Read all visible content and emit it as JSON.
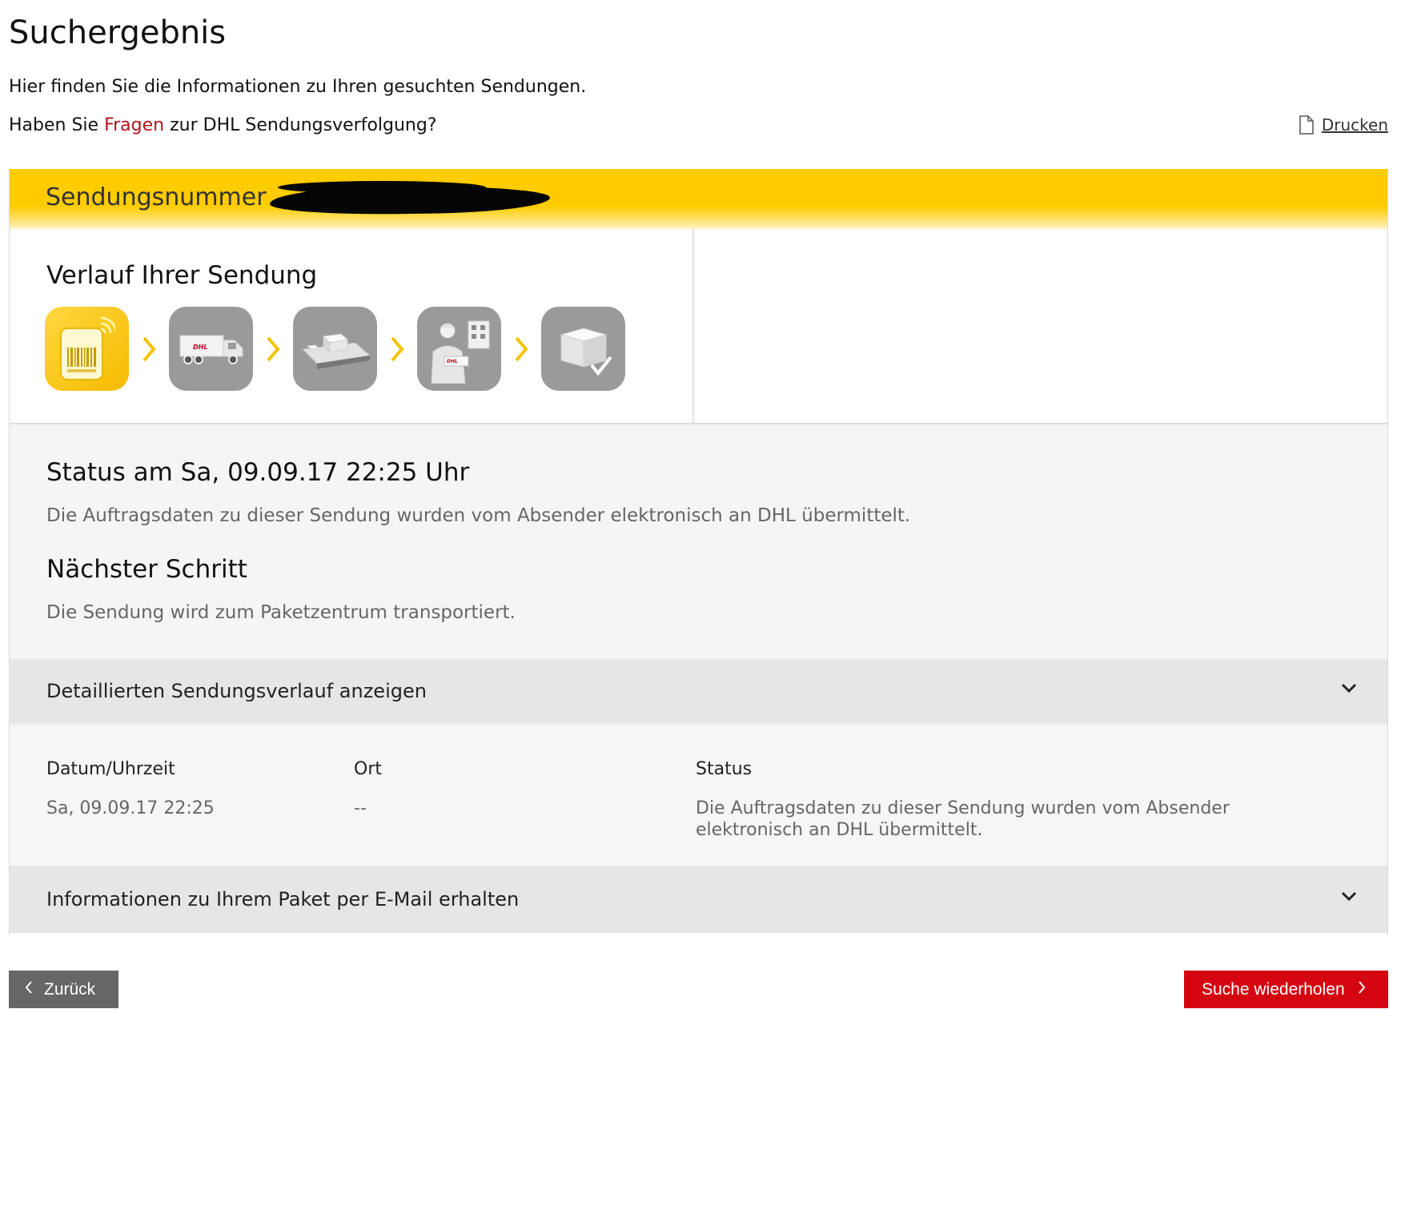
{
  "page": {
    "title": "Suchergebnis",
    "intro": "Hier finden Sie die Informationen zu Ihren gesuchten Sendungen.",
    "question_prefix": "Haben Sie",
    "question_link": "Fragen",
    "question_suffix": "zur DHL Sendungsverfolgung?",
    "print_label": "Drucken"
  },
  "shipment": {
    "number_label": "Sendungsnummer",
    "progress_title": "Verlauf Ihrer Sendung",
    "steps": [
      {
        "icon": "barcode-label-icon",
        "active": true
      },
      {
        "icon": "dhl-truck-icon",
        "active": false
      },
      {
        "icon": "parcel-center-conveyor-icon",
        "active": false
      },
      {
        "icon": "courier-delivery-icon",
        "active": false
      },
      {
        "icon": "delivered-parcel-check-icon",
        "active": false
      }
    ],
    "status_title": "Status am Sa, 09.09.17 22:25 Uhr",
    "status_text": "Die Auftragsdaten zu dieser Sendung wurden vom Absender elektronisch an DHL übermittelt.",
    "next_step_title": "Nächster Schritt",
    "next_step_text": "Die Sendung wird zum Paketzentrum transportiert."
  },
  "details": {
    "toggle_label": "Detaillierten Sendungsverlauf anzeigen",
    "columns": [
      "Datum/Uhrzeit",
      "Ort",
      "Status"
    ],
    "rows": [
      {
        "datetime": "Sa, 09.09.17 22:25",
        "location": "--",
        "status": "Die Auftragsdaten zu dieser Sendung wurden vom Absender elektronisch an DHL übermittelt."
      }
    ]
  },
  "email": {
    "toggle_label": "Informationen zu Ihrem Paket per E-Mail erhalten"
  },
  "buttons": {
    "back": "Zurück",
    "repeat_search": "Suche wiederholen"
  },
  "colors": {
    "dhl_yellow": "#ffcc00",
    "dhl_red": "#d40511",
    "button_grey": "#666666",
    "step_grey": "#9a9a9a"
  }
}
